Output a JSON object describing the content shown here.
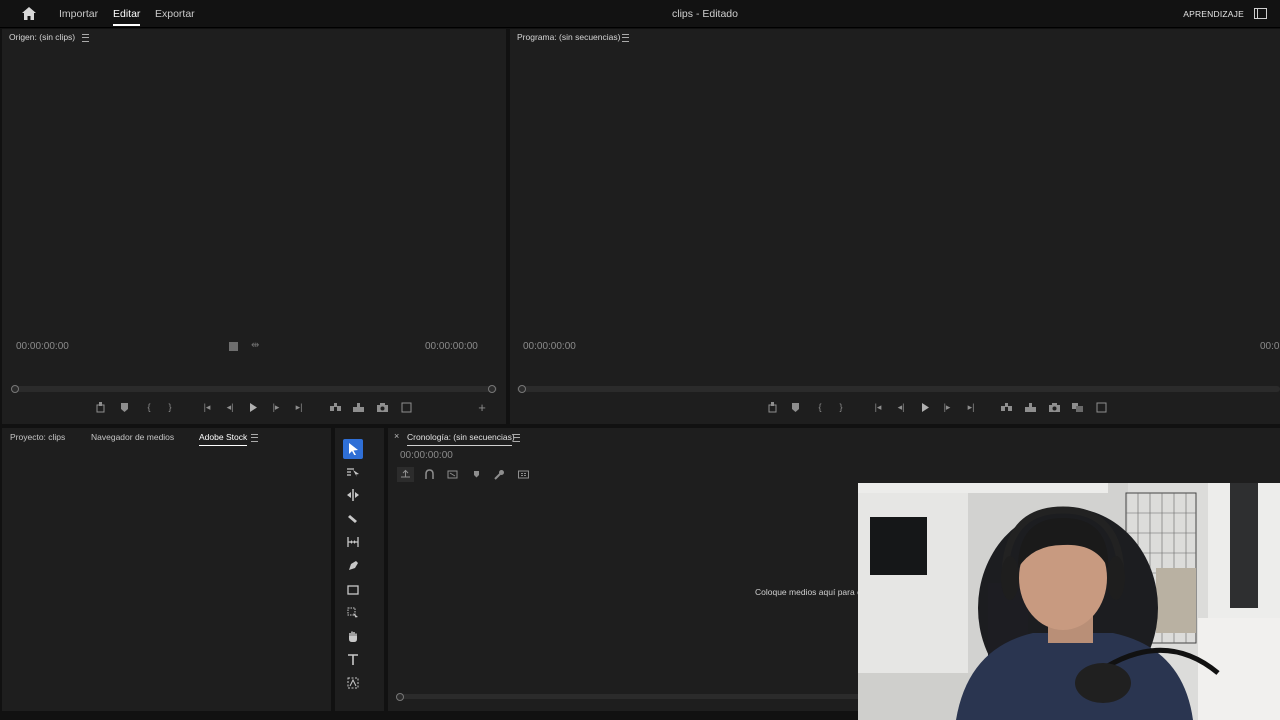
{
  "topbar": {
    "nav": [
      "Importar",
      "Editar",
      "Exportar"
    ],
    "active_nav": "Editar",
    "title": "clips - Editado",
    "learn_label": "APRENDIZAJE"
  },
  "source_monitor": {
    "title": "Origen: (sin clips)",
    "timecode_left": "00:00:00:00",
    "timecode_right": "00:00:00:00"
  },
  "program_monitor": {
    "title": "Programa: (sin secuencias)",
    "timecode_left": "00:00:00:00",
    "timecode_right_partial": "00:0"
  },
  "project_panel": {
    "tabs": [
      "Proyecto: clips",
      "Navegador de medios",
      "Adobe Stock"
    ],
    "active_tab": "Adobe Stock"
  },
  "timeline": {
    "close_glyph": "×",
    "title": "Cronología: (sin secuencias)",
    "timecode": "00:00:00:00",
    "drop_hint": "Coloque medios aquí para c"
  },
  "tools": [
    "selection-tool",
    "track-select-tool",
    "ripple-edit-tool",
    "razor-tool",
    "slip-tool",
    "pen-tool",
    "rectangle-tool",
    "zoom-tool",
    "hand-tool",
    "type-tool",
    "remix-tool"
  ],
  "colors": {
    "accent": "#2f6fd6",
    "panel_bg": "#1e1e1e",
    "frame_bg": "#111111"
  }
}
